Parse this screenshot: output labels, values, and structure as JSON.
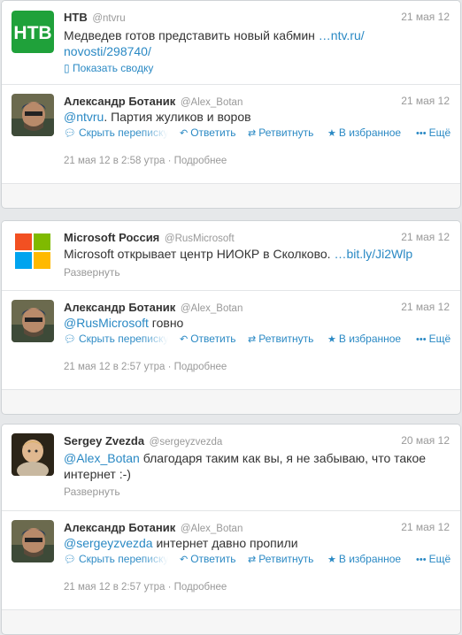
{
  "threads": [
    {
      "original": {
        "name": "НТВ",
        "handle": "@ntvru",
        "date": "21 мая 12",
        "text_line1": "Медведев готов представить новый кабмин",
        "link_line1": "ntv.ru/",
        "link_line2": "novosti/298740/",
        "expand": "Показать сводку"
      },
      "reply": {
        "name": "Александр Ботаник",
        "handle": "@Alex_Botan",
        "date": "21 мая 12",
        "mention": "@ntvru",
        "text": ". Партия жуликов и воров",
        "timestamp": "21 мая 12 в 2:58 утра",
        "details": "Подробнее"
      }
    },
    {
      "original": {
        "name": "Microsoft Россия",
        "handle": "@RusMicrosoft",
        "date": "21 мая 12",
        "text": "Microsoft открывает центр НИОКР в Сколково.",
        "link": "bit.ly/Ji2Wlp",
        "expand": "Развернуть"
      },
      "reply": {
        "name": "Александр Ботаник",
        "handle": "@Alex_Botan",
        "date": "21 мая 12",
        "mention": "@RusMicrosoft",
        "text": " говно",
        "timestamp": "21 мая 12 в 2:57 утра",
        "details": "Подробнее"
      }
    },
    {
      "original": {
        "name": "Sergey Zvezda",
        "handle": "@sergeyzvezda",
        "date": "20 мая 12",
        "mention": "@Alex_Botan",
        "text_line1": " благодаря таким как вы, я не забываю, что такое",
        "text_line2": "интернет :-)",
        "expand": "Развернуть"
      },
      "reply": {
        "name": "Александр Ботаник",
        "handle": "@Alex_Botan",
        "date": "21 мая 12",
        "mention": "@sergeyzvezda",
        "text": " интернет давно пропили",
        "timestamp": "21 мая 12 в 2:57 утра",
        "details": "Подробнее"
      }
    }
  ],
  "actions": {
    "conversation": "Скрыть переписку",
    "reply": "Ответить",
    "retweet": "Ретвитнуть",
    "favorite": "В избранное",
    "more": "Ещё"
  },
  "colors": {
    "link": "#2a89c4",
    "ntv_green": "#1fa13a"
  },
  "icons": {
    "ntv_logo": "ntv-logo-icon",
    "microsoft_logo": "microsoft-logo-icon"
  }
}
